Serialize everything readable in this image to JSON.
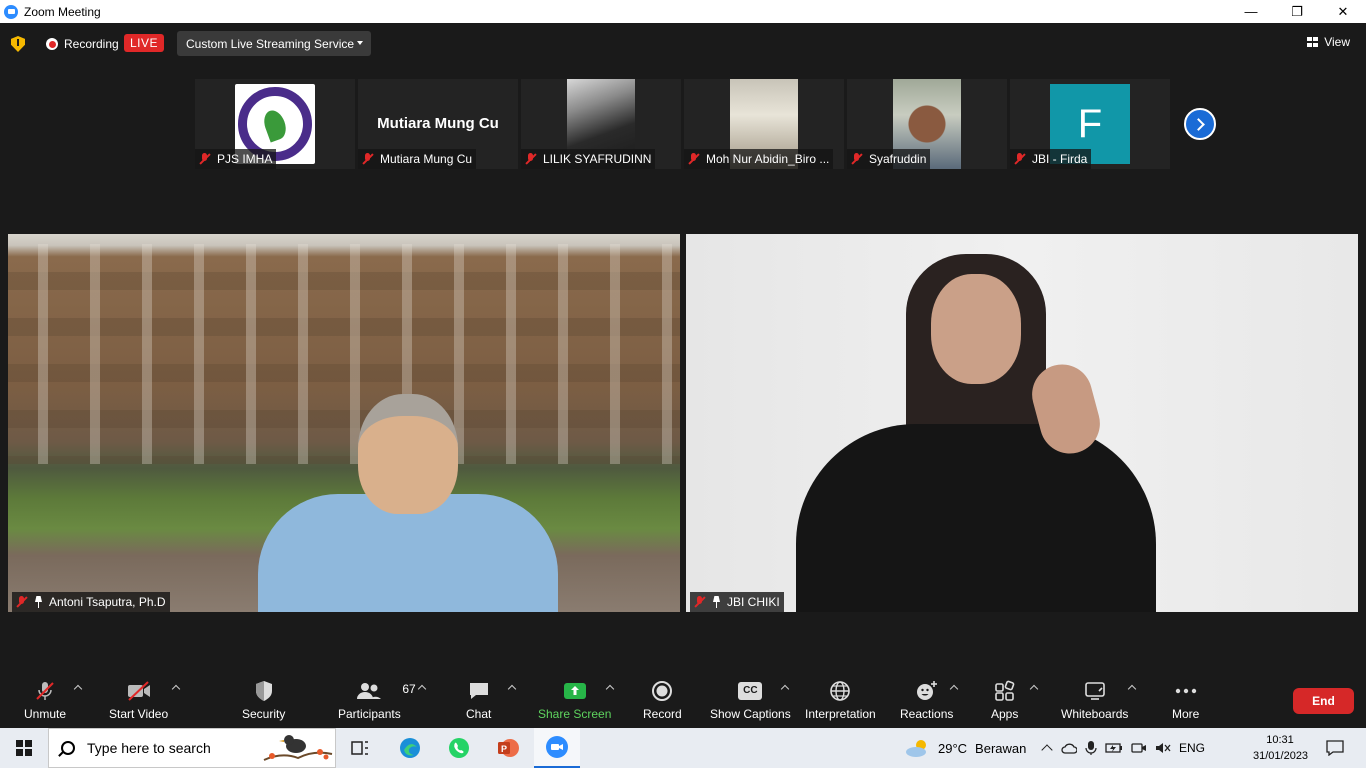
{
  "window": {
    "title": "Zoom Meeting",
    "controls": {
      "minimize": "—",
      "restore": "❐",
      "close": "✕"
    }
  },
  "meeting_bar": {
    "recording_label": "Recording",
    "live_badge": "LIVE",
    "streaming_service": "Custom Live Streaming Service",
    "view_label": "View"
  },
  "thumbnails": [
    {
      "name": "PJS IMHA",
      "muted": true,
      "tile": "logo"
    },
    {
      "name": "Mutiara Mung Cu",
      "muted": true,
      "tile": "name",
      "display_name": "Mutiara Mung Cu"
    },
    {
      "name": "LILIK SYAFRUDINN",
      "muted": true,
      "tile": "camera"
    },
    {
      "name": "Moh Nur Abidin_Biro ...",
      "muted": true,
      "tile": "camera"
    },
    {
      "name": "Syafruddin",
      "muted": true,
      "tile": "camera"
    },
    {
      "name": "JBI - Firda",
      "muted": true,
      "tile": "avatar",
      "avatar_letter": "F"
    }
  ],
  "main_videos": [
    {
      "name": "Antoni Tsaputra, Ph.D",
      "muted": true,
      "pinned": true
    },
    {
      "name": "JBI CHIKI",
      "muted": true,
      "pinned": true
    }
  ],
  "toolbar": {
    "unmute": "Unmute",
    "start_video": "Start Video",
    "security": "Security",
    "participants": "Participants",
    "participants_count": "67",
    "chat": "Chat",
    "share_screen": "Share Screen",
    "record": "Record",
    "show_captions": "Show Captions",
    "captions_icon_text": "CC",
    "interpretation": "Interpretation",
    "reactions": "Reactions",
    "apps": "Apps",
    "whiteboards": "Whiteboards",
    "more": "More",
    "end": "End"
  },
  "taskbar": {
    "search_placeholder": "Type here to search",
    "weather_temp": "29°C",
    "weather_desc": "Berawan",
    "language": "ENG",
    "time": "10:31",
    "date": "31/01/2023"
  },
  "colors": {
    "live_red": "#e02828",
    "share_green": "#27b548",
    "end_red": "#d62828",
    "accent_blue": "#1a6bd6",
    "avatar_teal": "#1197a8"
  }
}
